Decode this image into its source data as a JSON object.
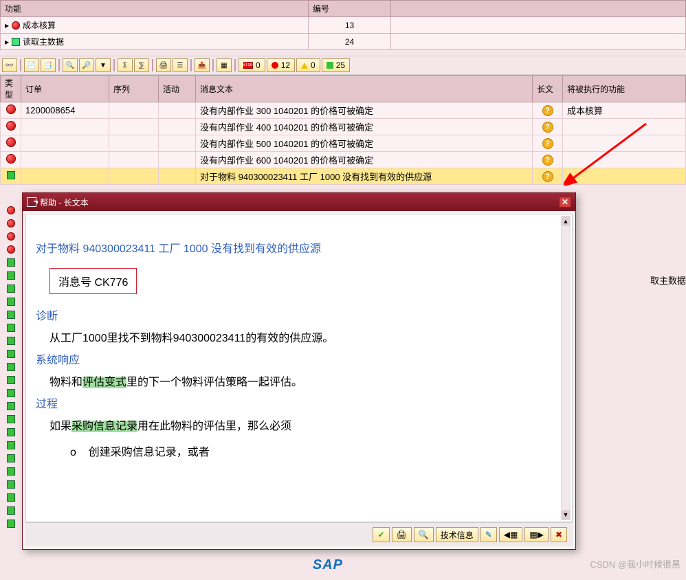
{
  "top": {
    "col_function": "功能",
    "col_number": "编号",
    "rows": [
      {
        "icon": "red",
        "label": "成本核算",
        "num": "13"
      },
      {
        "icon": "green",
        "label": "读取主数据",
        "num": "24"
      }
    ]
  },
  "toolbar_status": {
    "stop_label": "0",
    "red_count": "12",
    "yellow_count": "0",
    "green_count": "25"
  },
  "grid": {
    "headers": {
      "type": "类型",
      "order": "订单",
      "seq": "序列",
      "act": "活动",
      "msg": "消息文本",
      "long": "长文",
      "func": "将被执行的功能"
    },
    "rows": [
      {
        "type": "red",
        "order": "1200008654",
        "msg": "没有内部作业 300 1040201 的价格可被确定",
        "func": "成本核算"
      },
      {
        "type": "red",
        "msg": "没有内部作业 400 1040201 的价格可被确定"
      },
      {
        "type": "red",
        "msg": "没有内部作业 500 1040201 的价格可被确定"
      },
      {
        "type": "red",
        "msg": "没有内部作业 600 1040201 的价格可被确定"
      },
      {
        "type": "green",
        "msg": "对于物料 940300023411 工厂 1000 没有找到有效的供应源",
        "hl": true
      }
    ]
  },
  "left_strip": [
    "red",
    "red",
    "red",
    "red",
    "green",
    "green",
    "green",
    "green",
    "green",
    "green",
    "green",
    "green",
    "green",
    "green",
    "green",
    "green",
    "green",
    "green",
    "green",
    "green",
    "green",
    "green",
    "green",
    "green",
    "green"
  ],
  "right_peek": "取主数据",
  "dialog": {
    "title": "帮助 - 长文本",
    "heading": "对于物料 940300023411 工厂 1000 没有找到有效的供应源",
    "msg_no": "消息号 CK776",
    "sec_diag": "诊断",
    "diag_body": "从工厂1000里找不到物料940300023411的有效的供应源。",
    "sec_resp": "系统响应",
    "resp_prefix": "物料和",
    "resp_hl": "评估变式",
    "resp_suffix": "里的下一个物料评估策略一起评估。",
    "sec_proc": "过程",
    "proc_prefix": "如果",
    "proc_hl": "采购信息记录",
    "proc_suffix": "用在此物料的评估里，那么必须",
    "proc_item": "创建采购信息记录，或者",
    "tech_info": "技术信息"
  },
  "footer": {
    "sap": "SAP",
    "watermark": "CSDN @我小时候很黑"
  }
}
